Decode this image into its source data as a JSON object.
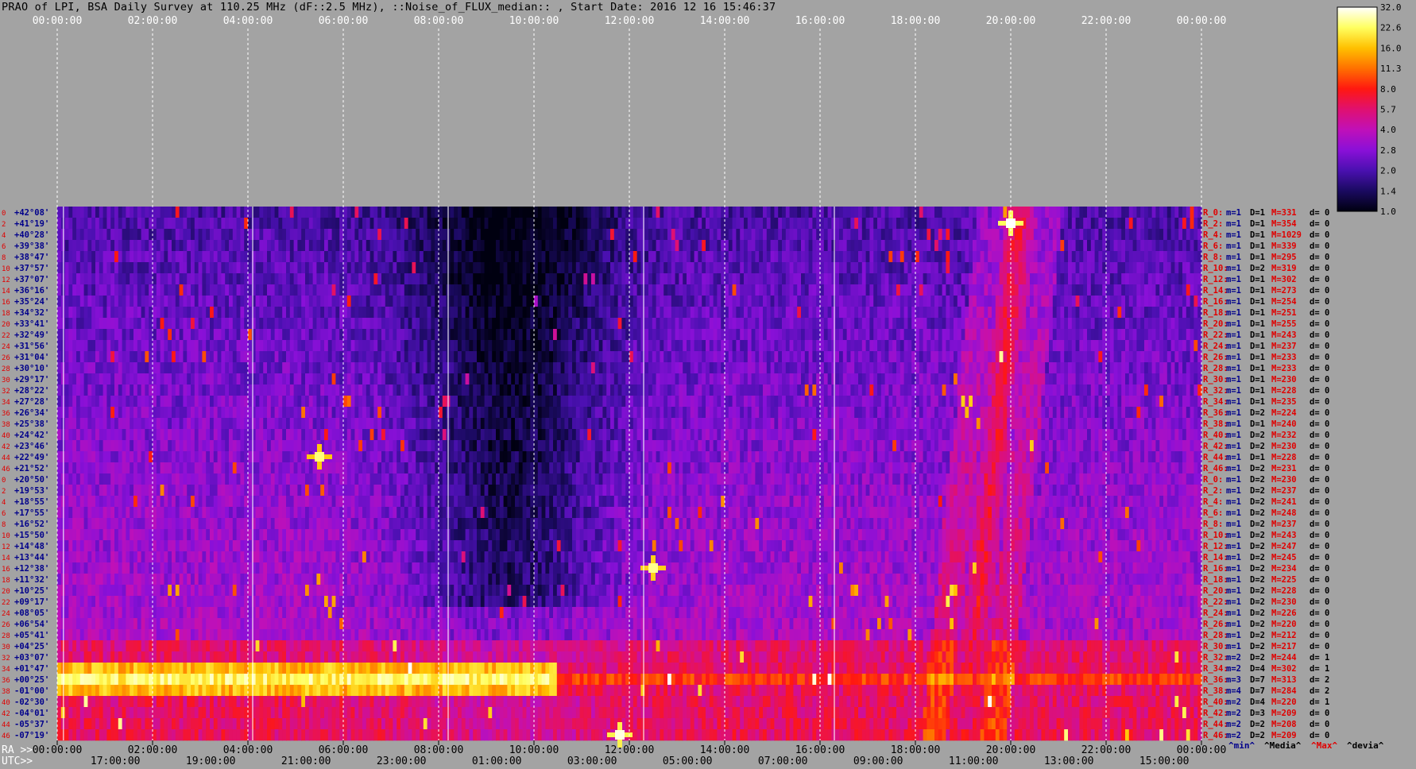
{
  "title": "PRAO of LPI, BSA Daily Survey at 110.25 MHz (dF::2.5 MHz), ::Noise_of_FLUX_median:: , Start Date: 2016 12 16 15:46:37",
  "chart_data": {
    "type": "heatmap",
    "top_axis_labels": [
      "00:00:00",
      "02:00:00",
      "04:00:00",
      "06:00:00",
      "08:00:00",
      "10:00:00",
      "12:00:00",
      "14:00:00",
      "16:00:00",
      "18:00:00",
      "20:00:00",
      "22:00:00",
      "00:00:00"
    ],
    "ra_axis_prefix": "RA >>",
    "ra_axis_labels": [
      "00:00:00",
      "02:00:00",
      "04:00:00",
      "06:00:00",
      "08:00:00",
      "10:00:00",
      "12:00:00",
      "14:00:00",
      "16:00:00",
      "18:00:00",
      "20:00:00",
      "22:00:00",
      "00:00:00"
    ],
    "utc_axis_prefix": "UTC>>",
    "utc_axis_labels": [
      "17:00:00",
      "19:00:00",
      "21:00:00",
      "23:00:00",
      "01:00:00",
      "03:00:00",
      "05:00:00",
      "07:00:00",
      "09:00:00",
      "11:00:00",
      "13:00:00",
      "15:00:00"
    ],
    "row_indices": [
      "0",
      "2",
      "4",
      "6",
      "8",
      "10",
      "12",
      "14",
      "16",
      "18",
      "20",
      "22",
      "24",
      "26",
      "28",
      "30",
      "32",
      "34",
      "36",
      "38",
      "40",
      "42",
      "44",
      "46",
      "0",
      "2",
      "4",
      "6",
      "8",
      "10",
      "12",
      "14",
      "16",
      "18",
      "20",
      "22",
      "24",
      "26",
      "28",
      "30",
      "32",
      "34",
      "36",
      "38",
      "40",
      "42",
      "44",
      "46"
    ],
    "declinations": [
      "+42°08'",
      "+41°19'",
      "+40°28'",
      "+39°38'",
      "+38°47'",
      "+37°57'",
      "+37°07'",
      "+36°16'",
      "+35°24'",
      "+34°32'",
      "+33°41'",
      "+32°49'",
      "+31°56'",
      "+31°04'",
      "+30°10'",
      "+29°17'",
      "+28°22'",
      "+27°28'",
      "+26°34'",
      "+25°38'",
      "+24°42'",
      "+23°46'",
      "+22°49'",
      "+21°52'",
      "+20°50'",
      "+19°53'",
      "+18°55'",
      "+17°55'",
      "+16°52'",
      "+15°50'",
      "+14°48'",
      "+13°44'",
      "+12°38'",
      "+11°32'",
      "+10°25'",
      "+09°17'",
      "+08°05'",
      "+06°54'",
      "+05°41'",
      "+04°25'",
      "+03°07'",
      "+01°47'",
      "+00°25'",
      "-01°00'",
      "-02°30'",
      "-04°01'",
      "-05°37'",
      "-07°19'"
    ],
    "row_stats": [
      {
        "r": "R_0:",
        "m": "m=1",
        "D": "D=1",
        "M": "M=331",
        "d": "d= 0"
      },
      {
        "r": "R_2:",
        "m": "m=1",
        "D": "D=1",
        "M": "M=354",
        "d": "d= 0"
      },
      {
        "r": "R_4:",
        "m": "m=1",
        "D": "D=1",
        "M": "M=1029",
        "d": "d= 0"
      },
      {
        "r": "R_6:",
        "m": "m=1",
        "D": "D=1",
        "M": "M=339",
        "d": "d= 0"
      },
      {
        "r": "R_8:",
        "m": "m=1",
        "D": "D=1",
        "M": "M=295",
        "d": "d= 0"
      },
      {
        "r": "R_10:",
        "m": "m=1",
        "D": "D=2",
        "M": "M=319",
        "d": "d= 0"
      },
      {
        "r": "R_12:",
        "m": "m=1",
        "D": "D=1",
        "M": "M=302",
        "d": "d= 0"
      },
      {
        "r": "R_14:",
        "m": "m=1",
        "D": "D=1",
        "M": "M=273",
        "d": "d= 0"
      },
      {
        "r": "R_16:",
        "m": "m=1",
        "D": "D=1",
        "M": "M=254",
        "d": "d= 0"
      },
      {
        "r": "R_18:",
        "m": "m=1",
        "D": "D=1",
        "M": "M=251",
        "d": "d= 0"
      },
      {
        "r": "R_20:",
        "m": "m=1",
        "D": "D=1",
        "M": "M=255",
        "d": "d= 0"
      },
      {
        "r": "R_22:",
        "m": "m=1",
        "D": "D=1",
        "M": "M=243",
        "d": "d= 0"
      },
      {
        "r": "R_24:",
        "m": "m=1",
        "D": "D=1",
        "M": "M=237",
        "d": "d= 0"
      },
      {
        "r": "R_26:",
        "m": "m=1",
        "D": "D=1",
        "M": "M=233",
        "d": "d= 0"
      },
      {
        "r": "R_28:",
        "m": "m=1",
        "D": "D=1",
        "M": "M=233",
        "d": "d= 0"
      },
      {
        "r": "R_30:",
        "m": "m=1",
        "D": "D=1",
        "M": "M=230",
        "d": "d= 0"
      },
      {
        "r": "R_32:",
        "m": "m=1",
        "D": "D=1",
        "M": "M=228",
        "d": "d= 0"
      },
      {
        "r": "R_34:",
        "m": "m=1",
        "D": "D=1",
        "M": "M=235",
        "d": "d= 0"
      },
      {
        "r": "R_36:",
        "m": "m=1",
        "D": "D=2",
        "M": "M=224",
        "d": "d= 0"
      },
      {
        "r": "R_38:",
        "m": "m=1",
        "D": "D=1",
        "M": "M=240",
        "d": "d= 0"
      },
      {
        "r": "R_40:",
        "m": "m=1",
        "D": "D=2",
        "M": "M=232",
        "d": "d= 0"
      },
      {
        "r": "R_42:",
        "m": "m=1",
        "D": "D=2",
        "M": "M=230",
        "d": "d= 0"
      },
      {
        "r": "R_44:",
        "m": "m=1",
        "D": "D=1",
        "M": "M=228",
        "d": "d= 0"
      },
      {
        "r": "R_46:",
        "m": "m=1",
        "D": "D=2",
        "M": "M=231",
        "d": "d= 0"
      },
      {
        "r": "R_0:",
        "m": "m=1",
        "D": "D=2",
        "M": "M=230",
        "d": "d= 0"
      },
      {
        "r": "R_2:",
        "m": "m=1",
        "D": "D=2",
        "M": "M=237",
        "d": "d= 0"
      },
      {
        "r": "R_4:",
        "m": "m=1",
        "D": "D=2",
        "M": "M=241",
        "d": "d= 0"
      },
      {
        "r": "R_6:",
        "m": "m=1",
        "D": "D=2",
        "M": "M=248",
        "d": "d= 0"
      },
      {
        "r": "R_8:",
        "m": "m=1",
        "D": "D=2",
        "M": "M=237",
        "d": "d= 0"
      },
      {
        "r": "R_10:",
        "m": "m=1",
        "D": "D=2",
        "M": "M=243",
        "d": "d= 0"
      },
      {
        "r": "R_12:",
        "m": "m=1",
        "D": "D=2",
        "M": "M=247",
        "d": "d= 0"
      },
      {
        "r": "R_14:",
        "m": "m=1",
        "D": "D=2",
        "M": "M=245",
        "d": "d= 0"
      },
      {
        "r": "R_16:",
        "m": "m=1",
        "D": "D=2",
        "M": "M=234",
        "d": "d= 0"
      },
      {
        "r": "R_18:",
        "m": "m=1",
        "D": "D=2",
        "M": "M=225",
        "d": "d= 0"
      },
      {
        "r": "R_20:",
        "m": "m=1",
        "D": "D=2",
        "M": "M=228",
        "d": "d= 0"
      },
      {
        "r": "R_22:",
        "m": "m=1",
        "D": "D=2",
        "M": "M=230",
        "d": "d= 0"
      },
      {
        "r": "R_24:",
        "m": "m=1",
        "D": "D=2",
        "M": "M=226",
        "d": "d= 0"
      },
      {
        "r": "R_26:",
        "m": "m=1",
        "D": "D=2",
        "M": "M=220",
        "d": "d= 0"
      },
      {
        "r": "R_28:",
        "m": "m=1",
        "D": "D=2",
        "M": "M=212",
        "d": "d= 0"
      },
      {
        "r": "R_30:",
        "m": "m=1",
        "D": "D=2",
        "M": "M=217",
        "d": "d= 0"
      },
      {
        "r": "R_32:",
        "m": "m=2",
        "D": "D=2",
        "M": "M=244",
        "d": "d= 1"
      },
      {
        "r": "R_34:",
        "m": "m=2",
        "D": "D=4",
        "M": "M=302",
        "d": "d= 1"
      },
      {
        "r": "R_36:",
        "m": "m=3",
        "D": "D=7",
        "M": "M=313",
        "d": "d= 2"
      },
      {
        "r": "R_38:",
        "m": "m=4",
        "D": "D=7",
        "M": "M=284",
        "d": "d= 2"
      },
      {
        "r": "R_40:",
        "m": "m=2",
        "D": "D=4",
        "M": "M=220",
        "d": "d= 1"
      },
      {
        "r": "R_42:",
        "m": "m=2",
        "D": "D=3",
        "M": "M=209",
        "d": "d= 0"
      },
      {
        "r": "R_44:",
        "m": "m=2",
        "D": "D=2",
        "M": "M=208",
        "d": "d= 0"
      },
      {
        "r": "R_46:",
        "m": "m=2",
        "D": "D=2",
        "M": "M=209",
        "d": "d= 0"
      }
    ],
    "stats_legend": [
      {
        "text": "^min^",
        "color": "#00008b"
      },
      {
        "text": "^Media^",
        "color": "#000000"
      },
      {
        "text": "^Max^",
        "color": "#e00000"
      },
      {
        "text": "^devia^",
        "color": "#000000"
      }
    ],
    "colorbar_ticks": [
      "32.0",
      "22.6",
      "16.0",
      "11.3",
      "8.0",
      "5.7",
      "4.0",
      "2.8",
      "2.0",
      "1.4",
      "1.0"
    ],
    "colorbar_scale": "log",
    "colorbar_range": [
      1.0,
      32.0
    ],
    "features": {
      "hot_horizontal_band_rows": [
        41,
        42,
        43
      ],
      "hot_band_ra_hours": [
        0,
        11
      ],
      "diagonal_source_ra_hours": [
        19.0,
        20.2
      ],
      "bright_sources": [
        {
          "ra_hour": 20.0,
          "row": 1,
          "value": 32
        },
        {
          "ra_hour": 12.5,
          "row": 32,
          "value": 25
        },
        {
          "ra_hour": 5.5,
          "row": 22,
          "value": 24
        },
        {
          "ra_hour": 11.8,
          "row": 47,
          "value": 30
        }
      ]
    },
    "colors": {
      "background": "#a3a3a3",
      "grid_dashed": "#ffffff",
      "label_dark": "#00008b",
      "label_red": "#e00000"
    }
  }
}
